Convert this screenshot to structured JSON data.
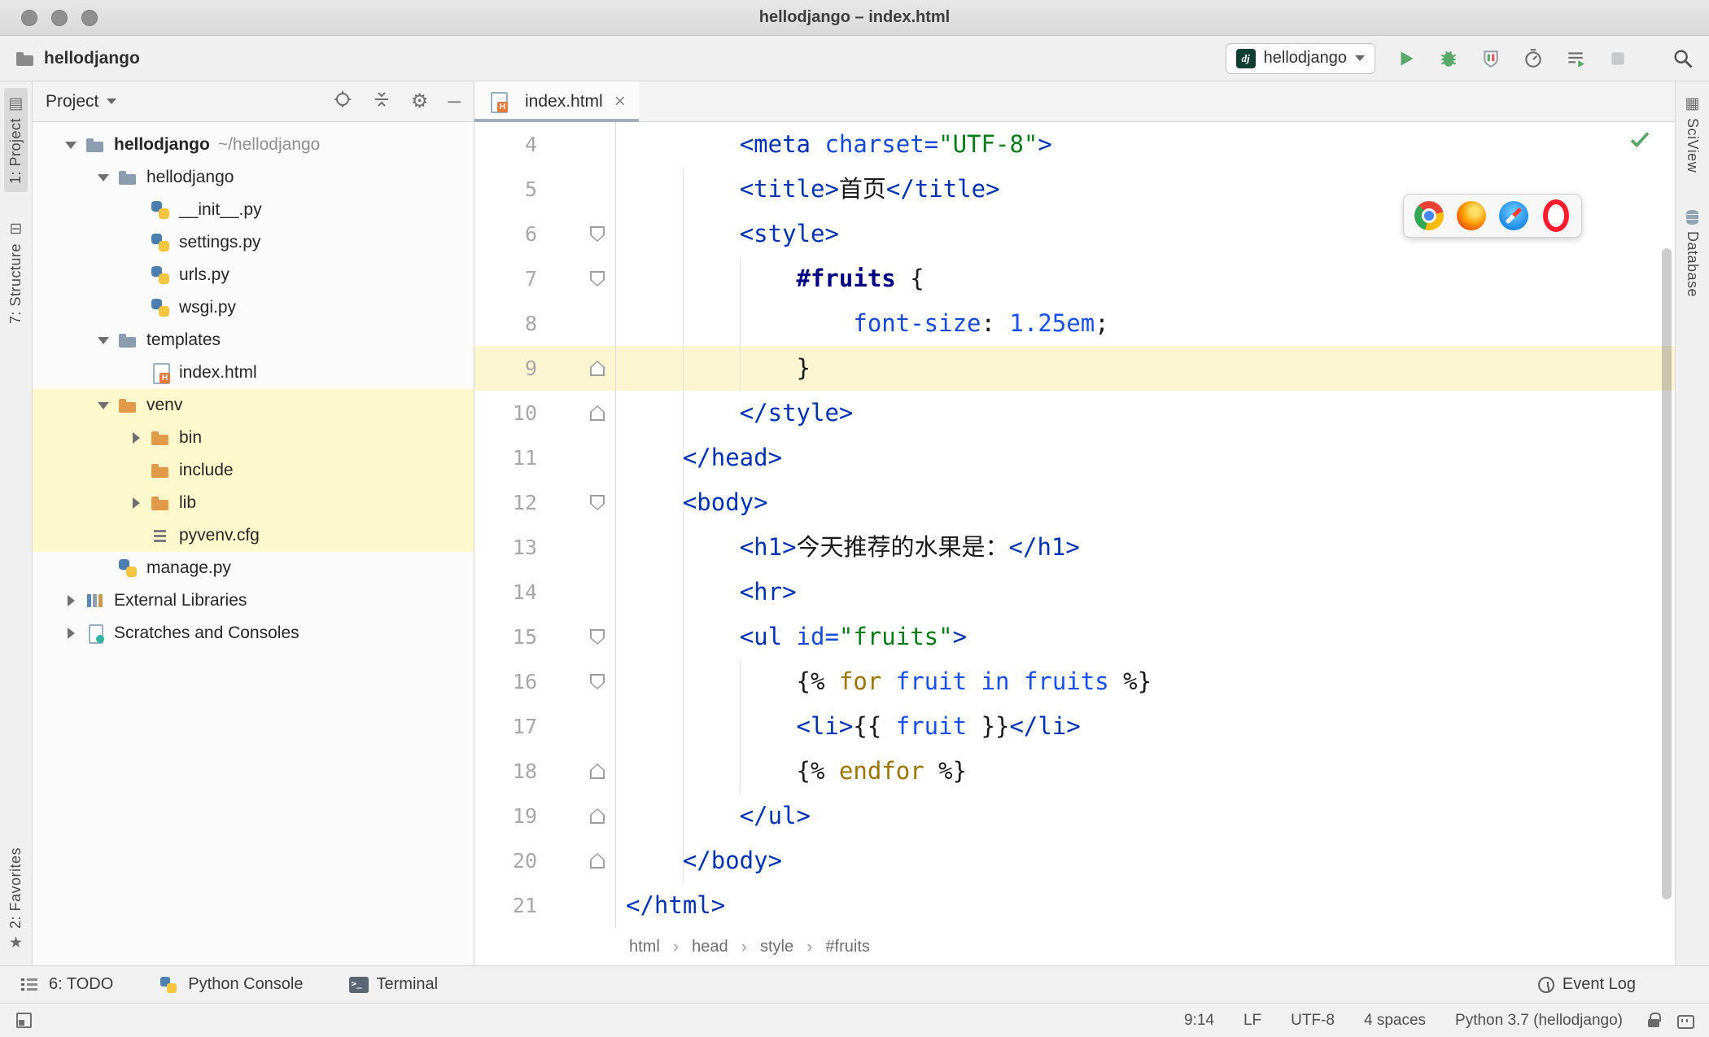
{
  "window": {
    "title": "hellodjango – index.html"
  },
  "toolbar": {
    "project_name": "hellodjango",
    "run_config": {
      "icon": "dj",
      "label": "hellodjango"
    }
  },
  "left_stripe": {
    "top": [
      "1: Project",
      "7: Structure"
    ],
    "bottom": [
      "2: Favorites"
    ]
  },
  "right_stripe": [
    "SciView",
    "Database"
  ],
  "project_panel": {
    "title": "Project",
    "tree": [
      {
        "label": "hellodjango",
        "suffix": "~/hellodjango",
        "level": 0,
        "icon": "folder",
        "arrow": "open",
        "bold": true
      },
      {
        "label": "hellodjango",
        "level": 1,
        "icon": "folder",
        "arrow": "open"
      },
      {
        "label": "__init__.py",
        "level": 2,
        "icon": "python"
      },
      {
        "label": "settings.py",
        "level": 2,
        "icon": "python"
      },
      {
        "label": "urls.py",
        "level": 2,
        "icon": "python"
      },
      {
        "label": "wsgi.py",
        "level": 2,
        "icon": "python"
      },
      {
        "label": "templates",
        "level": 1,
        "icon": "folder",
        "arrow": "open"
      },
      {
        "label": "index.html",
        "level": 2,
        "icon": "html"
      },
      {
        "label": "venv",
        "level": 1,
        "icon": "folder-ex",
        "arrow": "open",
        "hl": true
      },
      {
        "label": "bin",
        "level": 2,
        "icon": "folder-ex",
        "arrow": "closed",
        "hl": true
      },
      {
        "label": "include",
        "level": 2,
        "icon": "folder-ex",
        "hl": true
      },
      {
        "label": "lib",
        "level": 2,
        "icon": "folder-ex",
        "arrow": "closed",
        "hl": true
      },
      {
        "label": "pyvenv.cfg",
        "level": 2,
        "icon": "cfg",
        "hl": true
      },
      {
        "label": "manage.py",
        "level": 1,
        "icon": "python"
      },
      {
        "label": "External Libraries",
        "level": 0,
        "icon": "libs",
        "arrow": "closed"
      },
      {
        "label": "Scratches and Consoles",
        "level": 0,
        "icon": "scratch",
        "arrow": "closed"
      }
    ]
  },
  "editor": {
    "tab": {
      "label": "index.html"
    },
    "caret_line": 9,
    "browsers": [
      "chrome",
      "firefox",
      "safari",
      "opera"
    ],
    "breadcrumbs": [
      "html",
      "head",
      "style",
      "#fruits"
    ],
    "lines": [
      {
        "num": 4,
        "tokens": [
          [
            "        ",
            "pl"
          ],
          [
            "<meta ",
            "tag"
          ],
          [
            "charset=",
            "attr"
          ],
          [
            "\"UTF-8\"",
            "str"
          ],
          [
            ">",
            "tag"
          ]
        ]
      },
      {
        "num": 5,
        "tokens": [
          [
            "        ",
            "pl"
          ],
          [
            "<title>",
            "tag"
          ],
          [
            "首页",
            "pl"
          ],
          [
            "</title>",
            "tag"
          ]
        ]
      },
      {
        "num": 6,
        "fold": "down",
        "tokens": [
          [
            "        ",
            "pl"
          ],
          [
            "<style>",
            "tag"
          ]
        ]
      },
      {
        "num": 7,
        "fold": "down",
        "tokens": [
          [
            "            ",
            "pl"
          ],
          [
            "#fruits",
            "sel"
          ],
          [
            " {",
            "pl"
          ]
        ]
      },
      {
        "num": 8,
        "tokens": [
          [
            "                ",
            "pl"
          ],
          [
            "font-size",
            "prop"
          ],
          [
            ": ",
            "pl"
          ],
          [
            "1.25em",
            "num"
          ],
          [
            ";",
            "pl"
          ]
        ]
      },
      {
        "num": 9,
        "fold": "up",
        "tokens": [
          [
            "            ",
            "pl"
          ],
          [
            "}",
            "pl"
          ]
        ]
      },
      {
        "num": 10,
        "fold": "up",
        "tokens": [
          [
            "        ",
            "pl"
          ],
          [
            "</style>",
            "tag"
          ]
        ]
      },
      {
        "num": 11,
        "tokens": [
          [
            "    ",
            "pl"
          ],
          [
            "</head>",
            "tag"
          ]
        ]
      },
      {
        "num": 12,
        "fold": "down",
        "tokens": [
          [
            "    ",
            "pl"
          ],
          [
            "<body>",
            "tag"
          ]
        ]
      },
      {
        "num": 13,
        "tokens": [
          [
            "        ",
            "pl"
          ],
          [
            "<h1>",
            "tag"
          ],
          [
            "今天推荐的水果是：",
            "pl"
          ],
          [
            "</h1>",
            "tag"
          ]
        ]
      },
      {
        "num": 14,
        "tokens": [
          [
            "        ",
            "pl"
          ],
          [
            "<hr>",
            "tag"
          ]
        ]
      },
      {
        "num": 15,
        "fold": "down",
        "tokens": [
          [
            "        ",
            "pl"
          ],
          [
            "<ul ",
            "tag"
          ],
          [
            "id=",
            "attr"
          ],
          [
            "\"fruits\"",
            "str"
          ],
          [
            ">",
            "tag"
          ]
        ]
      },
      {
        "num": 16,
        "fold": "down",
        "tokens": [
          [
            "            ",
            "pl"
          ],
          [
            "{% ",
            "pl"
          ],
          [
            "for",
            "dj"
          ],
          [
            " ",
            "pl"
          ],
          [
            "fruit",
            "var"
          ],
          [
            " ",
            "pl"
          ],
          [
            "in",
            "var"
          ],
          [
            " ",
            "pl"
          ],
          [
            "fruits",
            "var"
          ],
          [
            " %}",
            "pl"
          ]
        ]
      },
      {
        "num": 17,
        "tokens": [
          [
            "            ",
            "pl"
          ],
          [
            "<li>",
            "tag"
          ],
          [
            "{{ ",
            "pl"
          ],
          [
            "fruit",
            "var"
          ],
          [
            " }}",
            "pl"
          ],
          [
            "</li>",
            "tag"
          ]
        ]
      },
      {
        "num": 18,
        "fold": "up",
        "tokens": [
          [
            "            ",
            "pl"
          ],
          [
            "{% ",
            "pl"
          ],
          [
            "endfor",
            "dj"
          ],
          [
            " %}",
            "pl"
          ]
        ]
      },
      {
        "num": 19,
        "fold": "up",
        "tokens": [
          [
            "        ",
            "pl"
          ],
          [
            "</ul>",
            "tag"
          ]
        ]
      },
      {
        "num": 20,
        "fold": "up",
        "tokens": [
          [
            "    ",
            "pl"
          ],
          [
            "</body>",
            "tag"
          ]
        ]
      },
      {
        "num": 21,
        "tokens": [
          [
            "</html>",
            "tag"
          ]
        ]
      }
    ]
  },
  "bottom_bar": {
    "left": [
      {
        "label": "6: TODO",
        "icon": "todo"
      },
      {
        "label": "Python Console",
        "icon": "python"
      },
      {
        "label": "Terminal",
        "icon": "terminal"
      }
    ],
    "right": {
      "label": "Event Log",
      "icon": "event"
    }
  },
  "status_bar": {
    "items": [
      "9:14",
      "LF",
      "UTF-8",
      "4 spaces",
      "Python 3.7 (hellodjango)"
    ]
  },
  "colors": {
    "run_green": "#59a869",
    "error_red": "#db5860",
    "caret_line_bg": "#fcf5d1",
    "venv_highlight_bg": "#fdf9cc",
    "tag_blue": "#0033b3",
    "string_green": "#067d17"
  }
}
